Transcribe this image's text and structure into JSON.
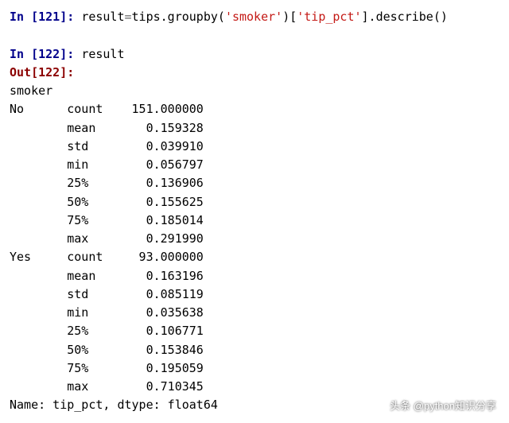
{
  "cells": {
    "input1": {
      "prompt_label": "In [",
      "prompt_num": "121",
      "prompt_close": "]: ",
      "code_lhs": "result",
      "code_eq": "=",
      "code_rhs1": "tips.groupby(",
      "code_str1": "'smoker'",
      "code_mid": ")[",
      "code_str2": "'tip_pct'",
      "code_tail": "].describe()"
    },
    "input2": {
      "prompt_label": "In [",
      "prompt_num": "122",
      "prompt_close": "]: ",
      "code": "result"
    },
    "output2": {
      "prompt_label": "Out[",
      "prompt_num": "122",
      "prompt_close": "]:"
    }
  },
  "result": {
    "index_name": "smoker",
    "groups": [
      {
        "label": "No",
        "stats": [
          {
            "name": "count",
            "value": "151.000000"
          },
          {
            "name": "mean",
            "value": "0.159328"
          },
          {
            "name": "std",
            "value": "0.039910"
          },
          {
            "name": "min",
            "value": "0.056797"
          },
          {
            "name": "25%",
            "value": "0.136906"
          },
          {
            "name": "50%",
            "value": "0.155625"
          },
          {
            "name": "75%",
            "value": "0.185014"
          },
          {
            "name": "max",
            "value": "0.291990"
          }
        ]
      },
      {
        "label": "Yes",
        "stats": [
          {
            "name": "count",
            "value": "93.000000"
          },
          {
            "name": "mean",
            "value": "0.163196"
          },
          {
            "name": "std",
            "value": "0.085119"
          },
          {
            "name": "min",
            "value": "0.035638"
          },
          {
            "name": "25%",
            "value": "0.106771"
          },
          {
            "name": "50%",
            "value": "0.153846"
          },
          {
            "name": "75%",
            "value": "0.195059"
          },
          {
            "name": "max",
            "value": "0.710345"
          }
        ]
      }
    ],
    "footer": "Name: tip_pct, dtype: float64"
  },
  "watermark": "头条 @python知识分享"
}
